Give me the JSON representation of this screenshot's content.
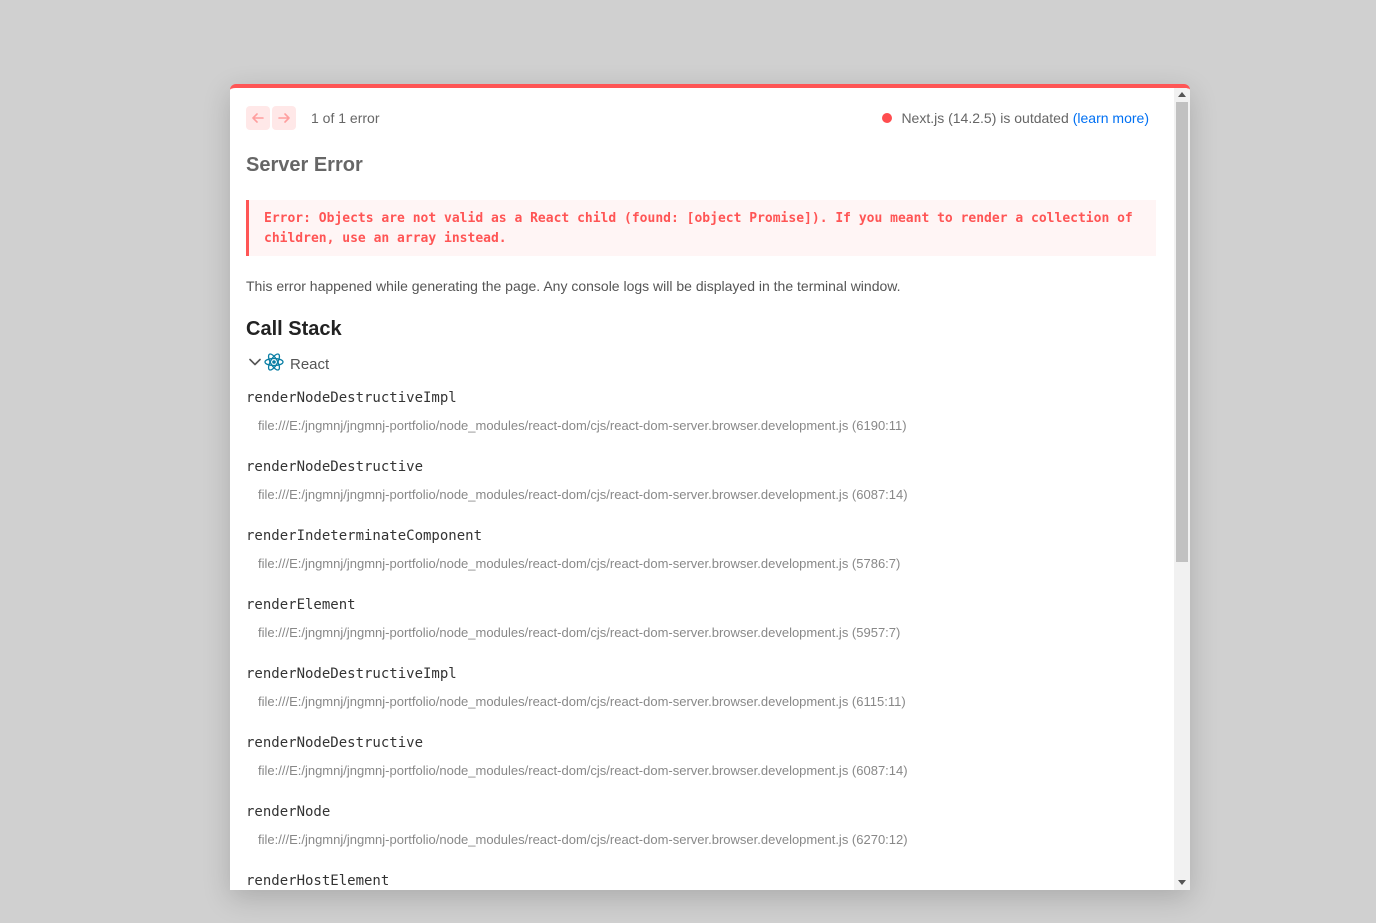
{
  "header": {
    "error_counter": "1 of 1 error",
    "version_text": "Next.js (14.2.5) is outdated",
    "learn_more": "(learn more)",
    "colors": {
      "accent": "#ff5555",
      "status_dot": "#ff4d4f",
      "link": "#0070f3"
    }
  },
  "main": {
    "title": "Server Error",
    "error_message": "Error: Objects are not valid as a React child (found: [object Promise]). If you meant to render a collection of children, use an array instead.",
    "info": "This error happened while generating the page. Any console logs will be displayed in the terminal window.",
    "callstack_title": "Call Stack",
    "group_label": "React",
    "frames": [
      {
        "fn": "renderNodeDestructiveImpl",
        "loc": "file:///E:/jngmnj/jngmnj-portfolio/node_modules/react-dom/cjs/react-dom-server.browser.development.js (6190:11)"
      },
      {
        "fn": "renderNodeDestructive",
        "loc": "file:///E:/jngmnj/jngmnj-portfolio/node_modules/react-dom/cjs/react-dom-server.browser.development.js (6087:14)"
      },
      {
        "fn": "renderIndeterminateComponent",
        "loc": "file:///E:/jngmnj/jngmnj-portfolio/node_modules/react-dom/cjs/react-dom-server.browser.development.js (5786:7)"
      },
      {
        "fn": "renderElement",
        "loc": "file:///E:/jngmnj/jngmnj-portfolio/node_modules/react-dom/cjs/react-dom-server.browser.development.js (5957:7)"
      },
      {
        "fn": "renderNodeDestructiveImpl",
        "loc": "file:///E:/jngmnj/jngmnj-portfolio/node_modules/react-dom/cjs/react-dom-server.browser.development.js (6115:11)"
      },
      {
        "fn": "renderNodeDestructive",
        "loc": "file:///E:/jngmnj/jngmnj-portfolio/node_modules/react-dom/cjs/react-dom-server.browser.development.js (6087:14)"
      },
      {
        "fn": "renderNode",
        "loc": "file:///E:/jngmnj/jngmnj-portfolio/node_modules/react-dom/cjs/react-dom-server.browser.development.js (6270:12)"
      },
      {
        "fn": "renderHostElement",
        "loc": ""
      }
    ]
  }
}
